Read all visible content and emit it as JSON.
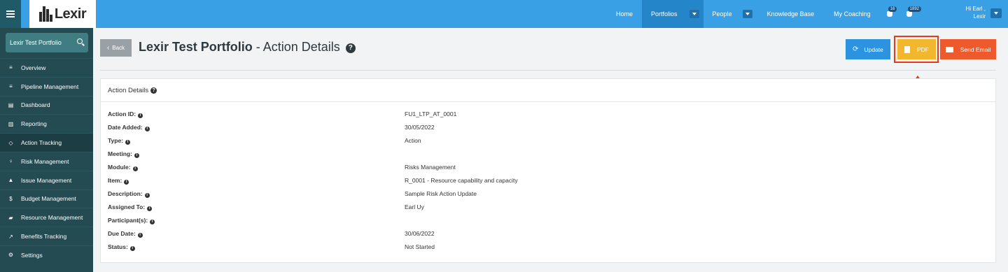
{
  "brand": {
    "logo_text": "Lexir"
  },
  "nav": {
    "items": [
      {
        "label": "Home"
      },
      {
        "label": "Portfolios"
      },
      {
        "label": "People"
      },
      {
        "label": "Knowledge Base"
      },
      {
        "label": "My Coaching"
      }
    ],
    "badges": {
      "alerts": "16",
      "messages": "1892"
    },
    "user": {
      "line1": "Hi Earl ,",
      "line2": "Lexir"
    }
  },
  "sidebar": {
    "search_value": "Lexir Test Portfolio",
    "items": [
      {
        "label": "Overview",
        "icon": "list-icon"
      },
      {
        "label": "Pipeline Management",
        "icon": "list-icon"
      },
      {
        "label": "Dashboard",
        "icon": "dashboard-icon"
      },
      {
        "label": "Reporting",
        "icon": "bar-chart-icon"
      },
      {
        "label": "Action Tracking",
        "icon": "crosshair-icon"
      },
      {
        "label": "Risk Management",
        "icon": "lightbulb-icon"
      },
      {
        "label": "Issue Management",
        "icon": "warning-icon"
      },
      {
        "label": "Budget Management",
        "icon": "dollar-icon"
      },
      {
        "label": "Resource Management",
        "icon": "folder-icon"
      },
      {
        "label": "Benefits Tracking",
        "icon": "line-chart-icon"
      },
      {
        "label": "Settings",
        "icon": "gears-icon"
      }
    ]
  },
  "page": {
    "back_label": "Back",
    "title_bold": "Lexir Test Portfolio",
    "title_rest": " - Action Details",
    "buttons": {
      "update": "Update",
      "pdf": "PDF",
      "email": "Send Email"
    }
  },
  "panel": {
    "title": "Action Details",
    "rows": [
      {
        "label": "Action ID:",
        "value": "FU1_LTP_AT_0001"
      },
      {
        "label": "Date Added:",
        "value": "30/05/2022"
      },
      {
        "label": "Type:",
        "value": "Action"
      },
      {
        "label": "Meeting:",
        "value": ""
      },
      {
        "label": "Module:",
        "value": "Risks Management"
      },
      {
        "label": "Item:",
        "value": "R_0001 - Resource capability and capacity"
      },
      {
        "label": "Description:",
        "value": "Sample Risk Action Update"
      },
      {
        "label": "Assigned To:",
        "value": "Earl Uy"
      },
      {
        "label": "Participant(s):",
        "value": ""
      },
      {
        "label": "Due Date:",
        "value": "30/06/2022"
      },
      {
        "label": "Status:",
        "value": "Not Started"
      }
    ]
  },
  "colors": {
    "topbar": "#3aa0e6",
    "sidebar": "#244a52",
    "update": "#2b93df",
    "pdf": "#f3b72d",
    "email": "#ee5a2b",
    "highlight": "#e53a1c"
  }
}
